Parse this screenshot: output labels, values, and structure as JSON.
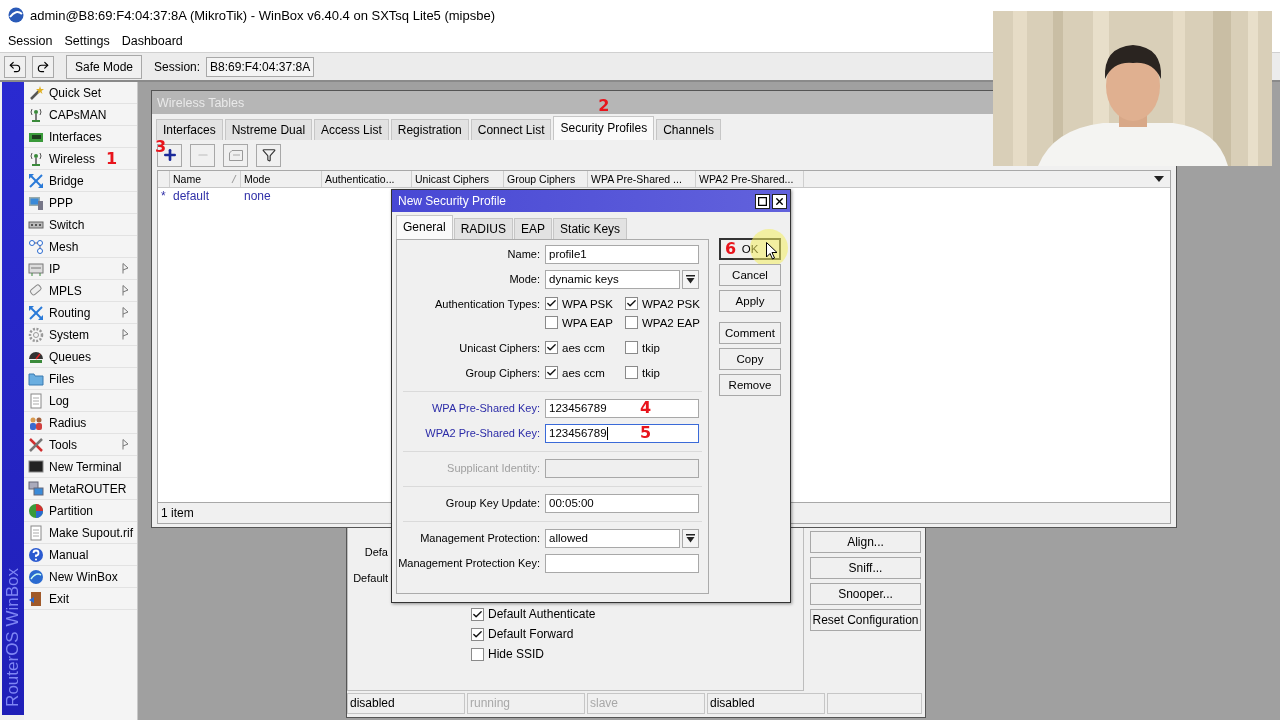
{
  "window": {
    "title": "admin@B8:69:F4:04:37:8A (MikroTik) - WinBox v6.40.4 on SXTsq Lite5 (mipsbe)"
  },
  "menu": [
    {
      "label": "Session"
    },
    {
      "label": "Settings"
    },
    {
      "label": "Dashboard"
    }
  ],
  "toolbar": {
    "safe_mode": "Safe Mode",
    "session_label": "Session:",
    "session_value": "B8:69:F4:04:37:8A"
  },
  "sidebar": {
    "brand": "RouterOS WinBox",
    "items": [
      {
        "label": "Quick Set",
        "submenu": false
      },
      {
        "label": "CAPsMAN",
        "submenu": false
      },
      {
        "label": "Interfaces",
        "submenu": false
      },
      {
        "label": "Wireless",
        "submenu": false,
        "annotation": "1"
      },
      {
        "label": "Bridge",
        "submenu": false
      },
      {
        "label": "PPP",
        "submenu": false
      },
      {
        "label": "Switch",
        "submenu": false
      },
      {
        "label": "Mesh",
        "submenu": false
      },
      {
        "label": "IP",
        "submenu": true
      },
      {
        "label": "MPLS",
        "submenu": true
      },
      {
        "label": "Routing",
        "submenu": true
      },
      {
        "label": "System",
        "submenu": true
      },
      {
        "label": "Queues",
        "submenu": false
      },
      {
        "label": "Files",
        "submenu": false
      },
      {
        "label": "Log",
        "submenu": false
      },
      {
        "label": "Radius",
        "submenu": false
      },
      {
        "label": "Tools",
        "submenu": true
      },
      {
        "label": "New Terminal",
        "submenu": false
      },
      {
        "label": "MetaROUTER",
        "submenu": false
      },
      {
        "label": "Partition",
        "submenu": false
      },
      {
        "label": "Make Supout.rif",
        "submenu": false
      },
      {
        "label": "Manual",
        "submenu": false
      },
      {
        "label": "New WinBox",
        "submenu": false
      },
      {
        "label": "Exit",
        "submenu": false
      }
    ]
  },
  "wireless_tables": {
    "title": "Wireless Tables",
    "tabs": [
      {
        "label": "Interfaces",
        "selected": false
      },
      {
        "label": "Nstreme Dual",
        "selected": false
      },
      {
        "label": "Access List",
        "selected": false
      },
      {
        "label": "Registration",
        "selected": false
      },
      {
        "label": "Connect List",
        "selected": false
      },
      {
        "label": "Security Profiles",
        "selected": true,
        "annotation": "2"
      },
      {
        "label": "Channels",
        "selected": false
      }
    ],
    "add_annotation": "3",
    "columns": [
      {
        "label": "Name",
        "sorted": true
      },
      {
        "label": "Mode",
        "sorted": false
      },
      {
        "label": "Authenticatio...",
        "sorted": false
      },
      {
        "label": "Unicast Ciphers",
        "sorted": false
      },
      {
        "label": "Group Ciphers",
        "sorted": false
      },
      {
        "label": "WPA Pre-Shared ...",
        "sorted": false
      },
      {
        "label": "WPA2 Pre-Shared...",
        "sorted": false
      }
    ],
    "rows": [
      {
        "flag": "*",
        "cells": [
          "default",
          "none"
        ]
      }
    ],
    "status": "1 item"
  },
  "interface_window": {
    "labels": [
      "Defa",
      "Default"
    ],
    "checkboxes": [
      {
        "label": "Default Authenticate",
        "checked": true
      },
      {
        "label": "Default Forward",
        "checked": true
      },
      {
        "label": "Hide SSID",
        "checked": false
      }
    ],
    "buttons": [
      "Align...",
      "Sniff...",
      "Snooper...",
      "Reset Configuration"
    ],
    "status": [
      {
        "text": "disabled",
        "dimmed": false
      },
      {
        "text": "running",
        "dimmed": true
      },
      {
        "text": "slave",
        "dimmed": true
      },
      {
        "text": "disabled",
        "dimmed": false
      }
    ]
  },
  "dialog": {
    "title": "New Security Profile",
    "tabs": [
      {
        "label": "General",
        "selected": true
      },
      {
        "label": "RADIUS",
        "selected": false
      },
      {
        "label": "EAP",
        "selected": false
      },
      {
        "label": "Static Keys",
        "selected": false
      }
    ],
    "sections": [
      [
        {
          "kind": "text",
          "label": "Name:",
          "value": "profile1",
          "modified": false,
          "disabled": false,
          "focused": false
        },
        {
          "kind": "select",
          "label": "Mode:",
          "value": "dynamic keys",
          "modified": false,
          "disabled": false
        },
        {
          "kind": "checks",
          "label": "Authentication Types:",
          "modified": false,
          "disabled": false,
          "options": [
            {
              "label": "WPA PSK",
              "checked": true
            },
            {
              "label": "WPA2 PSK",
              "checked": true
            },
            {
              "label": "WPA EAP",
              "checked": false
            },
            {
              "label": "WPA2 EAP",
              "checked": false
            }
          ]
        },
        {
          "kind": "checks",
          "label": "Unicast Ciphers:",
          "modified": false,
          "disabled": false,
          "options": [
            {
              "label": "aes ccm",
              "checked": true
            },
            {
              "label": "tkip",
              "checked": false
            }
          ]
        },
        {
          "kind": "checks",
          "label": "Group Ciphers:",
          "modified": false,
          "disabled": false,
          "options": [
            {
              "label": "aes ccm",
              "checked": true
            },
            {
              "label": "tkip",
              "checked": false
            }
          ]
        }
      ],
      [
        {
          "kind": "text",
          "label": "WPA Pre-Shared Key:",
          "value": "123456789",
          "modified": true,
          "disabled": false,
          "focused": false,
          "annotation": "4"
        },
        {
          "kind": "text",
          "label": "WPA2 Pre-Shared Key:",
          "value": "123456789",
          "modified": true,
          "disabled": false,
          "focused": true,
          "annotation": "5"
        }
      ],
      [
        {
          "kind": "text",
          "label": "Supplicant Identity:",
          "modified": false,
          "disabled": true,
          "focused": false
        }
      ],
      [
        {
          "kind": "text",
          "label": "Group Key Update:",
          "value": "00:05:00",
          "modified": false,
          "disabled": false,
          "focused": false
        }
      ],
      [
        {
          "kind": "select",
          "label": "Management Protection:",
          "value": "allowed",
          "modified": false,
          "disabled": false
        },
        {
          "kind": "text",
          "label": "Management Protection Key:",
          "modified": false,
          "disabled": false,
          "focused": false
        }
      ]
    ],
    "buttons": [
      [
        {
          "label": "OK",
          "focused": true,
          "annotation": "6"
        },
        {
          "label": "Cancel",
          "focused": false
        },
        {
          "label": "Apply",
          "focused": false
        }
      ],
      [
        {
          "label": "Comment",
          "focused": false
        },
        {
          "label": "Copy",
          "focused": false
        },
        {
          "label": "Remove",
          "focused": false
        }
      ]
    ]
  }
}
